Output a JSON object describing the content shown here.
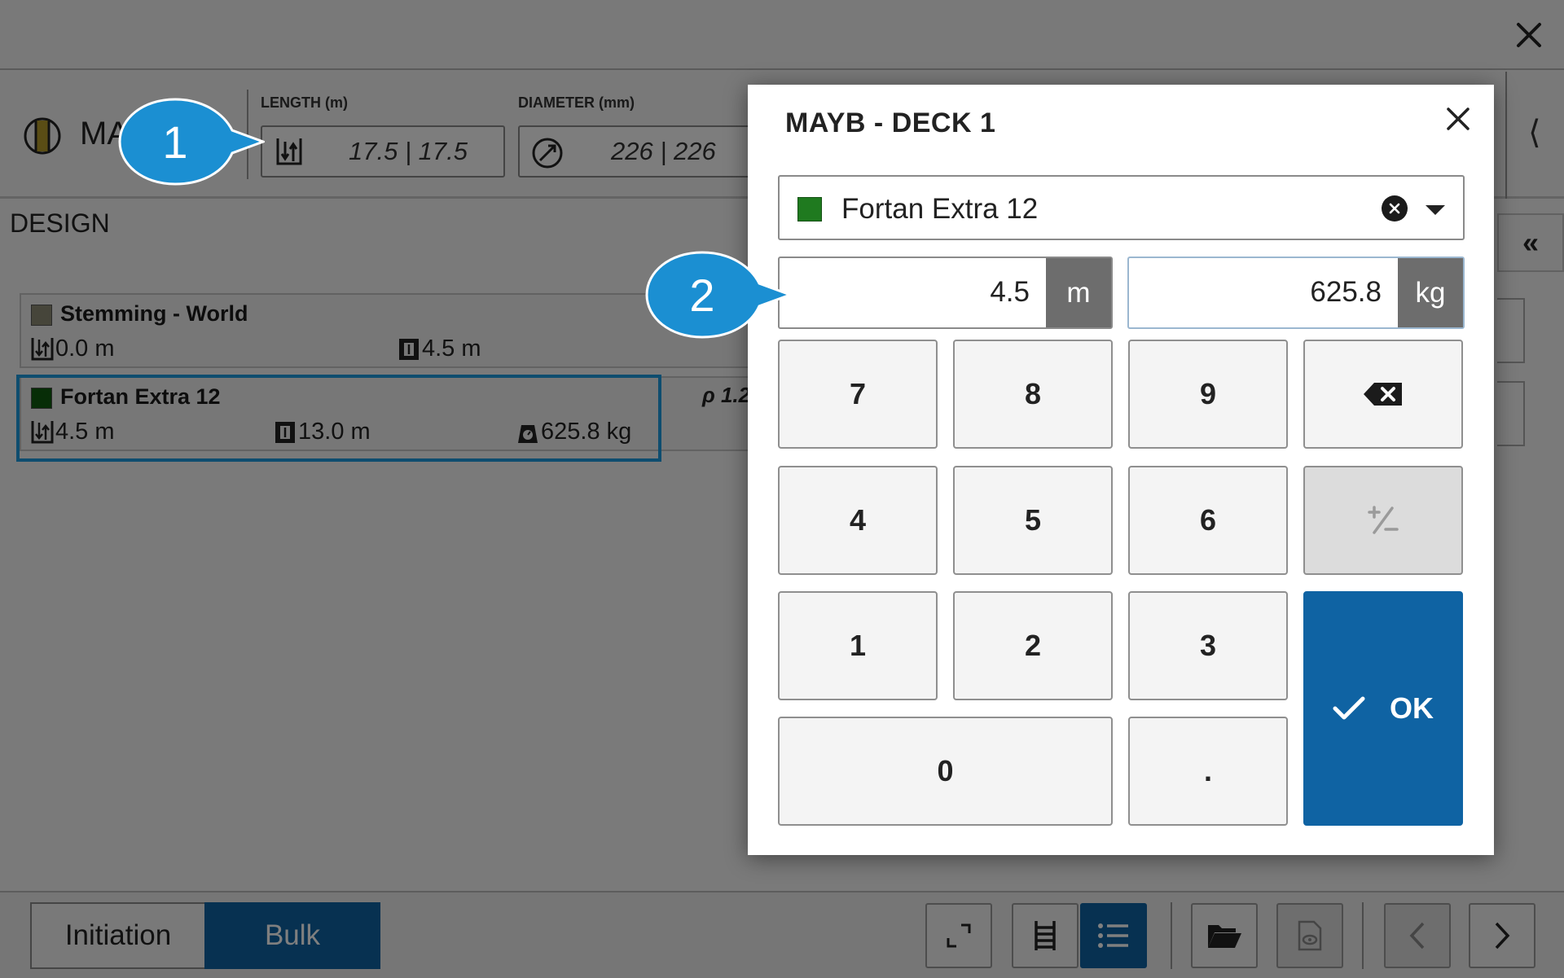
{
  "app": {
    "hole_name": "MA",
    "length": {
      "label": "LENGTH (m)",
      "value": "17.5 | 17.5"
    },
    "diameter": {
      "label": "DIAMETER (mm)",
      "value": "226 | 226"
    },
    "collapse_glyph": "⟨",
    "section_title": "DESIGN",
    "side_collapse_glyph": "«",
    "decks": [
      {
        "name": "Stemming - World",
        "color": "#8d8a74",
        "stats": [
          "0.0 m",
          "4.5 m"
        ]
      },
      {
        "name": "Fortan Extra 12",
        "color": "#0e5a0e",
        "stats": [
          "4.5 m",
          "13.0 m",
          "625.8 kg"
        ],
        "selected": true,
        "density_partial": "ρ 1.2"
      }
    ],
    "footer": {
      "tab_initiation": "Initiation",
      "tab_bulk": "Bulk",
      "buttons": [
        "expand-icon",
        "ladder-icon",
        "list-icon",
        "folder-open-icon",
        "document-view-icon",
        "chevron-left-icon",
        "chevron-right-icon"
      ]
    }
  },
  "modal": {
    "title": "MAYB - DECK 1",
    "product": {
      "name": "Fortan Extra 12",
      "color": "#1f7a1f"
    },
    "length_field": {
      "value": "4.5",
      "unit": "m"
    },
    "weight_field": {
      "value": "625.8",
      "unit": "kg"
    },
    "keys": {
      "k7": "7",
      "k8": "8",
      "k9": "9",
      "k4": "4",
      "k5": "5",
      "k6": "6",
      "k1": "1",
      "k2": "2",
      "k3": "3",
      "k0": "0",
      "kdot": ".",
      "ok": "OK"
    }
  },
  "callouts": {
    "one": "1",
    "two": "2"
  },
  "colors": {
    "accent_blue": "#0f63a3",
    "callout_blue": "#1b8fd2",
    "selection_outline": "#1c9bdf"
  }
}
